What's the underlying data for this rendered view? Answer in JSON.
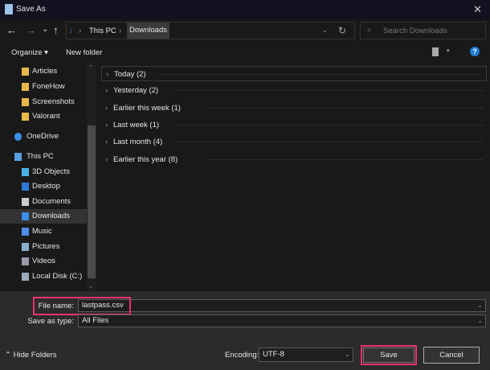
{
  "window": {
    "title": "Save As",
    "close": "✕"
  },
  "nav": {
    "back": "←",
    "forward": "→",
    "recent": "⌄",
    "up": "↑",
    "breadcrumb": [
      "This PC",
      "Downloads"
    ],
    "sep": "›",
    "refresh": "↻",
    "search_placeholder": "Search Downloads"
  },
  "toolbar": {
    "organize": "Organize ▾",
    "new_folder": "New folder",
    "help": "?"
  },
  "sidebar": {
    "items": [
      {
        "label": "Articles",
        "icon": "folder-icon"
      },
      {
        "label": "FoneHow",
        "icon": "folder-icon"
      },
      {
        "label": "Screenshots",
        "icon": "folder-icon"
      },
      {
        "label": "Valorant",
        "icon": "folder-icon"
      },
      {
        "label": "OneDrive",
        "icon": "cloud-icon"
      },
      {
        "label": "This PC",
        "icon": "computer-icon"
      },
      {
        "label": "3D Objects",
        "icon": "cube-icon"
      },
      {
        "label": "Desktop",
        "icon": "desktop-icon"
      },
      {
        "label": "Documents",
        "icon": "document-icon"
      },
      {
        "label": "Downloads",
        "icon": "download-icon",
        "selected": true
      },
      {
        "label": "Music",
        "icon": "music-icon"
      },
      {
        "label": "Pictures",
        "icon": "pictures-icon"
      },
      {
        "label": "Videos",
        "icon": "videos-icon"
      },
      {
        "label": "Local Disk (C:)",
        "icon": "disk-icon"
      }
    ]
  },
  "groups": [
    "Today (2)",
    "Yesterday (2)",
    "Earlier this week (1)",
    "Last week (1)",
    "Last month (4)",
    "Earlier this year (8)"
  ],
  "form": {
    "file_name_label": "File name:",
    "file_name_value": "lastpass.csv",
    "save_type_label": "Save as type:",
    "save_type_value": "All Files",
    "encoding_label": "Encoding:",
    "encoding_value": "UTF-8"
  },
  "footer": {
    "hide_folders": "Hide Folders",
    "save": "Save",
    "cancel": "Cancel"
  },
  "colors": {
    "highlight": "#e8336d",
    "accent": "#1e7ad6"
  }
}
